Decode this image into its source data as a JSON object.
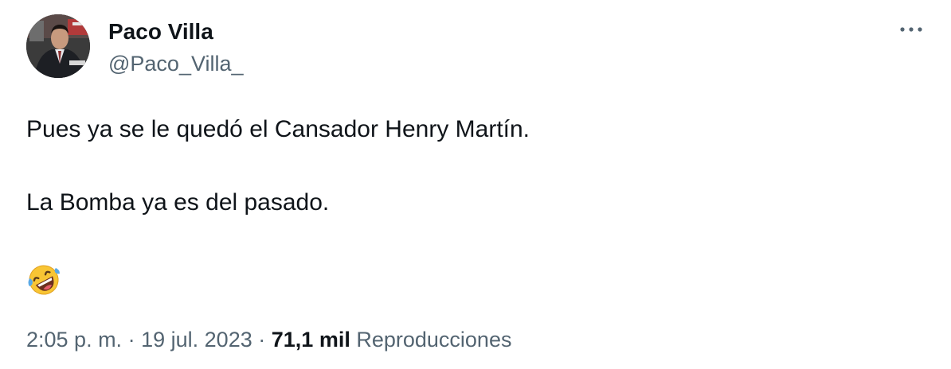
{
  "author": {
    "name": "Paco Villa",
    "handle": "@Paco_Villa_"
  },
  "tweet": {
    "lines": [
      "Pues ya se le quedó el Cansador Henry Martín.",
      "La Bomba ya es del pasado."
    ],
    "emoji": "rolling-on-the-floor-laughing"
  },
  "meta": {
    "time": "2:05 p. m.",
    "separator": "·",
    "date": "19 jul. 2023",
    "views_count": "71,1 mil",
    "views_label": "Reproducciones"
  },
  "icons": {
    "more": "more-dots-icon"
  },
  "colors": {
    "text": "#0f1419",
    "secondary": "#536471",
    "background": "#ffffff"
  }
}
